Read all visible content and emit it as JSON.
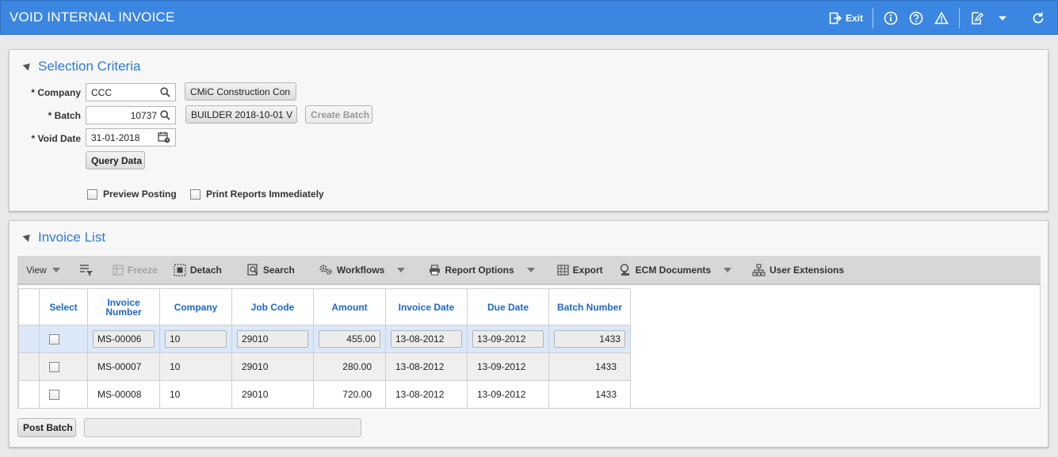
{
  "window": {
    "title": "VOID INTERNAL INVOICE",
    "exit_label": "Exit",
    "accent": "#3b86e0"
  },
  "selection": {
    "title": "Selection Criteria",
    "company": {
      "label": "Company",
      "value": "CCC",
      "name_value": "CMiC Construction Con"
    },
    "batch": {
      "label": "Batch",
      "value": "10737",
      "name_value": "BUILDER 2018-10-01 V",
      "create_label": "Create Batch"
    },
    "void_date": {
      "label": "Void Date",
      "value": "31-01-2018"
    },
    "query_label": "Query Data",
    "preview_posting": {
      "label": "Preview Posting",
      "checked": false
    },
    "print_reports": {
      "label": "Print Reports Immediately",
      "checked": false
    },
    "required_mark": "*"
  },
  "invoice_list": {
    "title": "Invoice List",
    "toolbar": {
      "view": "View",
      "freeze": "Freeze",
      "detach": "Detach",
      "search": "Search",
      "workflows": "Workflows",
      "report_options": "Report Options",
      "export": "Export",
      "ecm_documents": "ECM Documents",
      "user_extensions": "User Extensions"
    },
    "columns": {
      "select": "Select",
      "invoice_number_1": "Invoice",
      "invoice_number_2": "Number",
      "company": "Company",
      "job_code": "Job Code",
      "amount": "Amount",
      "invoice_date": "Invoice Date",
      "due_date": "Due Date",
      "batch_number": "Batch Number"
    },
    "rows": [
      {
        "invoice_number": "MS-00006",
        "company": "10",
        "job_code": "29010",
        "amount": "455.00",
        "invoice_date": "13-08-2012",
        "due_date": "13-09-2012",
        "batch_number": "1433",
        "selected": false
      },
      {
        "invoice_number": "MS-00007",
        "company": "10",
        "job_code": "29010",
        "amount": "280.00",
        "invoice_date": "13-08-2012",
        "due_date": "13-09-2012",
        "batch_number": "1433",
        "selected": false
      },
      {
        "invoice_number": "MS-00008",
        "company": "10",
        "job_code": "29010",
        "amount": "720.00",
        "invoice_date": "13-08-2012",
        "due_date": "13-09-2012",
        "batch_number": "1433",
        "selected": false
      }
    ],
    "post_batch_label": "Post Batch"
  }
}
